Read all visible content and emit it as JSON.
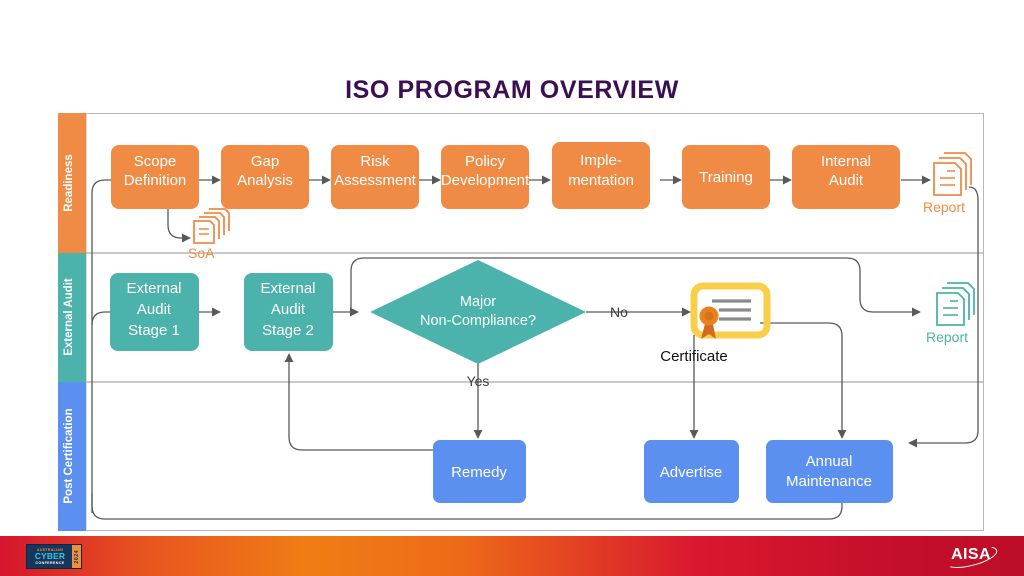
{
  "title": "ISO PROGRAM OVERVIEW",
  "colors": {
    "title": "#3b1053",
    "readiness": "#ef8b45",
    "external_audit": "#4bb3ac",
    "post_certification": "#5b8ff0",
    "certificate_frame": "#f9cf4a",
    "seal": "#e8821e",
    "connector": "#595959",
    "swimlane_border": "#b7b7b7"
  },
  "swimlanes": [
    {
      "id": "readiness",
      "label": "Readiness",
      "color": "#ef8b45"
    },
    {
      "id": "external-audit",
      "label": "External Audit",
      "color": "#4bb3ac"
    },
    {
      "id": "post-certification",
      "label": "Post Certification",
      "color": "#5b8ff0"
    }
  ],
  "readiness_steps": [
    {
      "id": "scope-definition",
      "lines": [
        "Scope",
        "Definition"
      ]
    },
    {
      "id": "gap-analysis",
      "lines": [
        "Gap",
        "Analysis"
      ]
    },
    {
      "id": "risk-assessment",
      "lines": [
        "Risk",
        "Assessment"
      ]
    },
    {
      "id": "policy-development",
      "lines": [
        "Policy",
        "Development"
      ]
    },
    {
      "id": "implementation",
      "lines": [
        "Imple-",
        "mentation"
      ]
    },
    {
      "id": "training",
      "lines": [
        "Training"
      ]
    },
    {
      "id": "internal-audit",
      "lines": [
        "Internal",
        "Audit"
      ]
    }
  ],
  "external_audit_steps": [
    {
      "id": "external-audit-stage-1",
      "lines": [
        "External",
        "Audit",
        "Stage 1"
      ]
    },
    {
      "id": "external-audit-stage-2",
      "lines": [
        "External",
        "Audit",
        "Stage 2"
      ]
    }
  ],
  "decision": {
    "id": "major-non-compliance",
    "lines": [
      "Major",
      "Non-Compliance?"
    ]
  },
  "branch_labels": {
    "no": "No",
    "yes": "Yes"
  },
  "artifacts": [
    {
      "id": "soa-document",
      "label": "SoA",
      "color": "#ef8b45",
      "lane": "readiness"
    },
    {
      "id": "internal-audit-report",
      "label": "Report",
      "color": "#ef8b45",
      "lane": "readiness"
    },
    {
      "id": "external-audit-report",
      "label": "Report",
      "color": "#4bb3ac",
      "lane": "external-audit"
    },
    {
      "id": "certificate",
      "label": "Certificate",
      "color": "#f9cf4a",
      "lane": "external-audit"
    }
  ],
  "post_certification_steps": [
    {
      "id": "remedy",
      "lines": [
        "Remedy"
      ]
    },
    {
      "id": "advertise",
      "lines": [
        "Advertise"
      ]
    },
    {
      "id": "annual-maintenance",
      "lines": [
        "Annual",
        "Maintenance"
      ]
    }
  ],
  "footer": {
    "conference_logo": {
      "line1": "AUSTRALIAN",
      "line2": "CYBER",
      "line3": "CONFERENCE",
      "year": "2024"
    },
    "org_logo": "AISA"
  }
}
